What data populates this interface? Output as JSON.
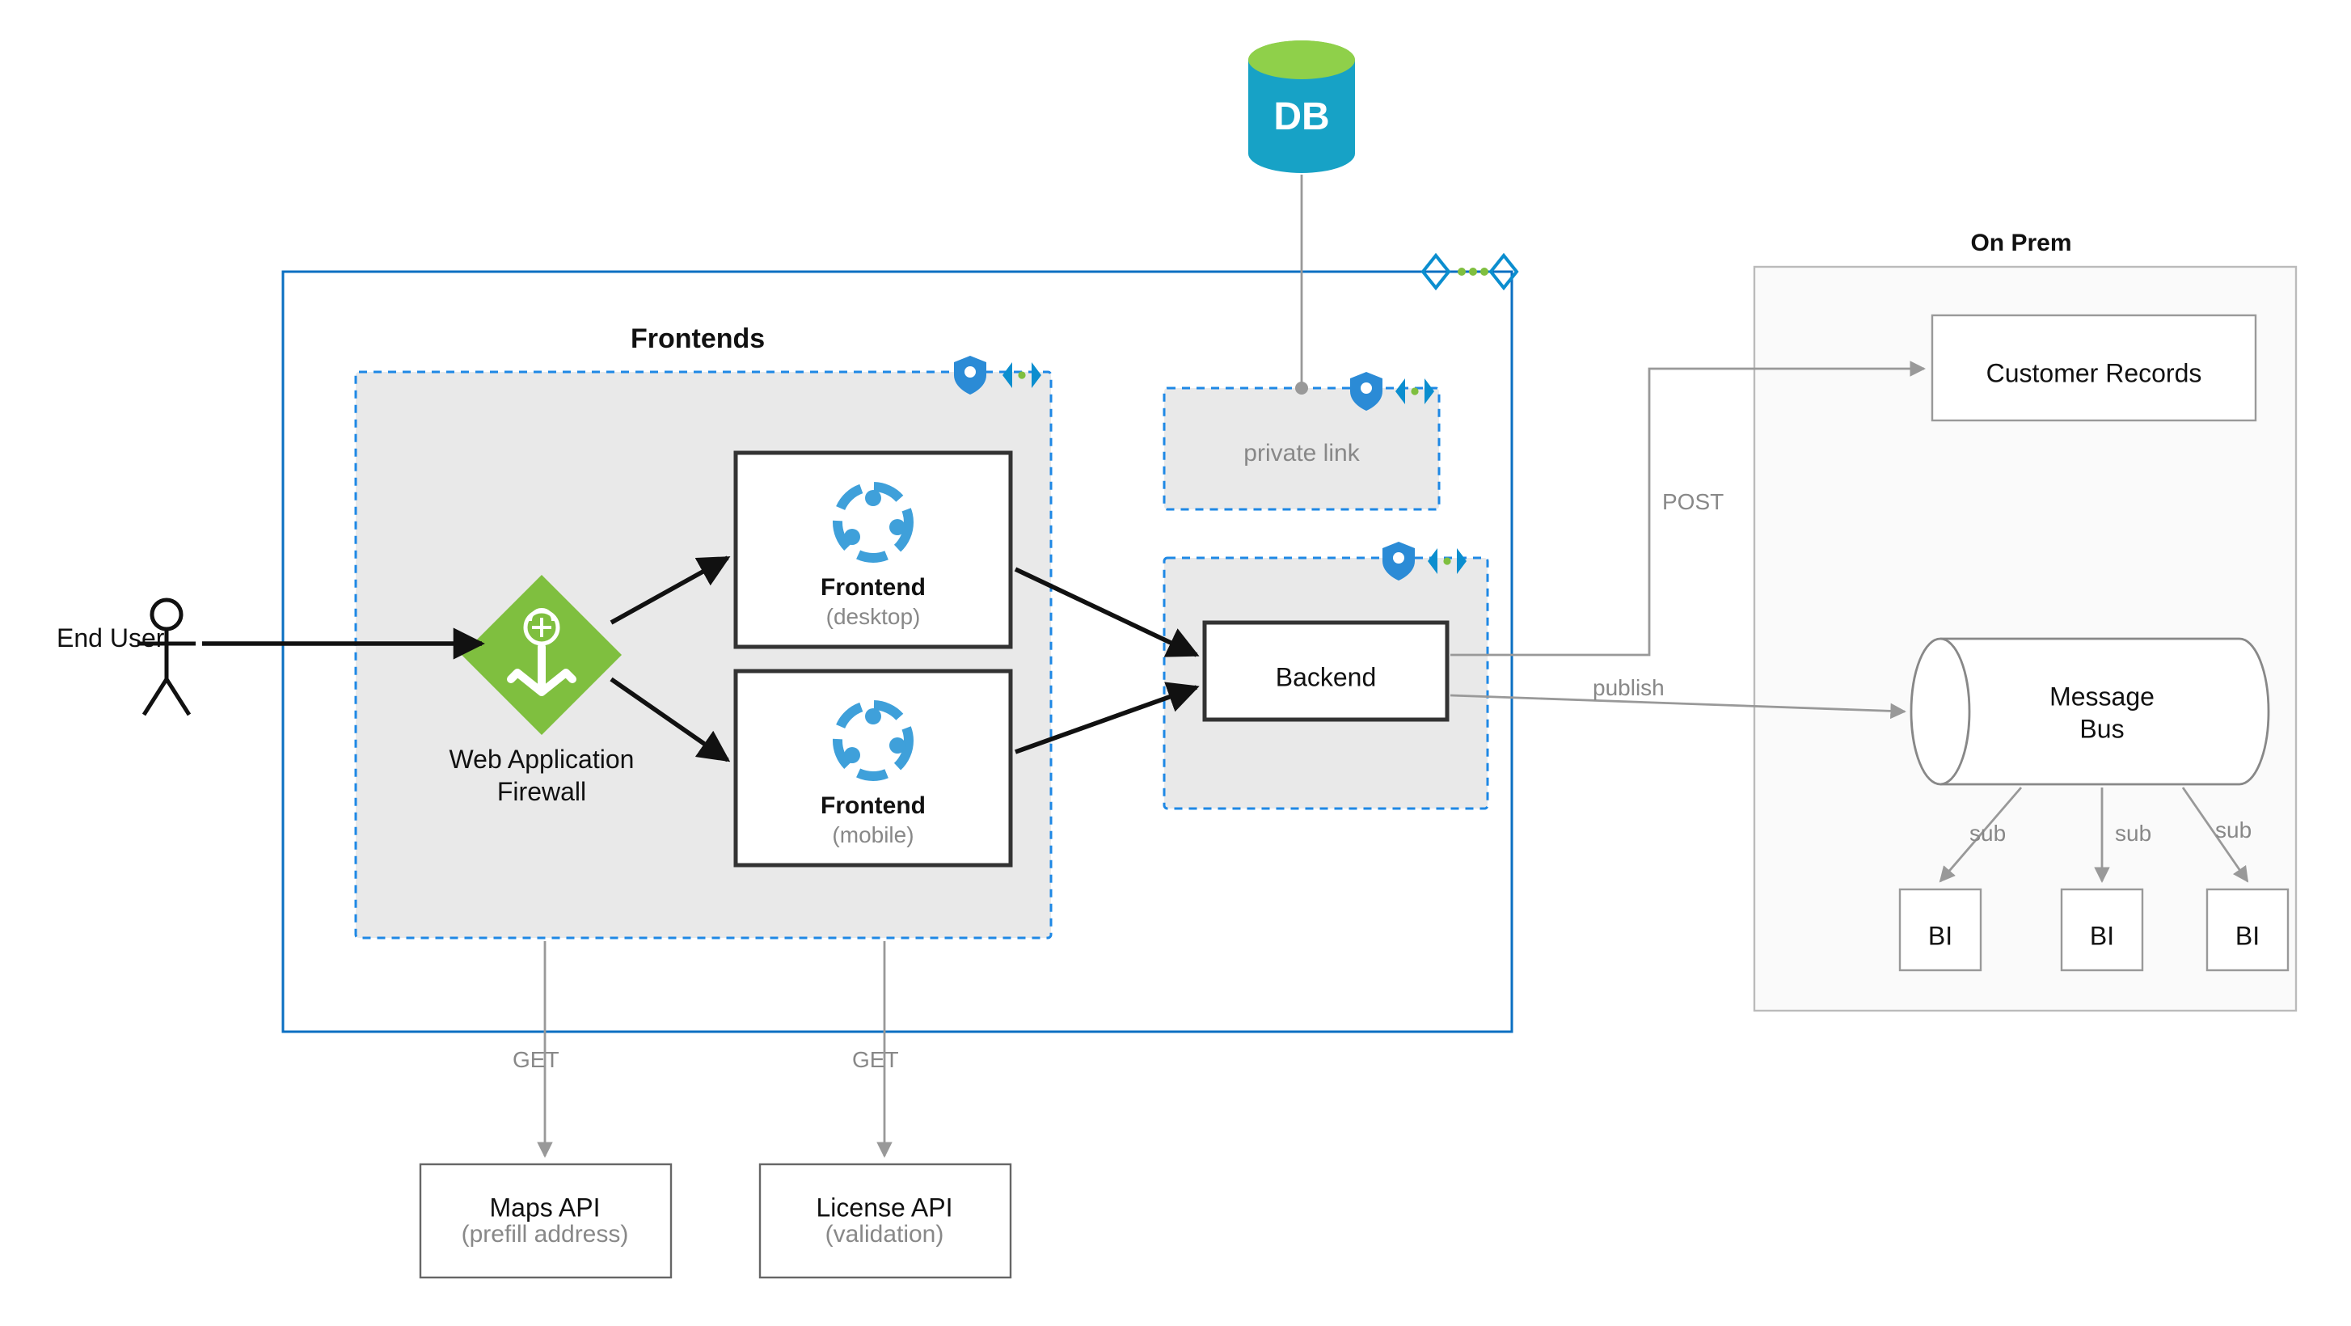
{
  "actors": {
    "end_user": "End User"
  },
  "cloud": {
    "frontends_title": "Frontends",
    "waf": {
      "title": "Web Application Firewall"
    },
    "frontend_desktop": {
      "title": "Frontend",
      "sub": "(desktop)"
    },
    "frontend_mobile": {
      "title": "Frontend",
      "sub": "(mobile)"
    },
    "backend": {
      "title": "Backend"
    },
    "private_link": {
      "title": "private link"
    },
    "db": {
      "title": "DB"
    }
  },
  "external_apis": {
    "maps": {
      "title": "Maps API",
      "sub": "(prefill address)",
      "method": "GET"
    },
    "license": {
      "title": "License API",
      "sub": "(validation)",
      "method": "GET"
    }
  },
  "onprem": {
    "title": "On Prem",
    "customer_records": "Customer Records",
    "message_bus": {
      "title": "Message Bus",
      "line2": ""
    },
    "subscribers": [
      "BI",
      "BI",
      "BI"
    ],
    "sub_label": "sub"
  },
  "edges": {
    "post": "POST",
    "publish": "publish"
  },
  "icons": {
    "shield": "shield-icon",
    "service": "service-icon",
    "cloud_badge": "cloud-badge-icon"
  }
}
